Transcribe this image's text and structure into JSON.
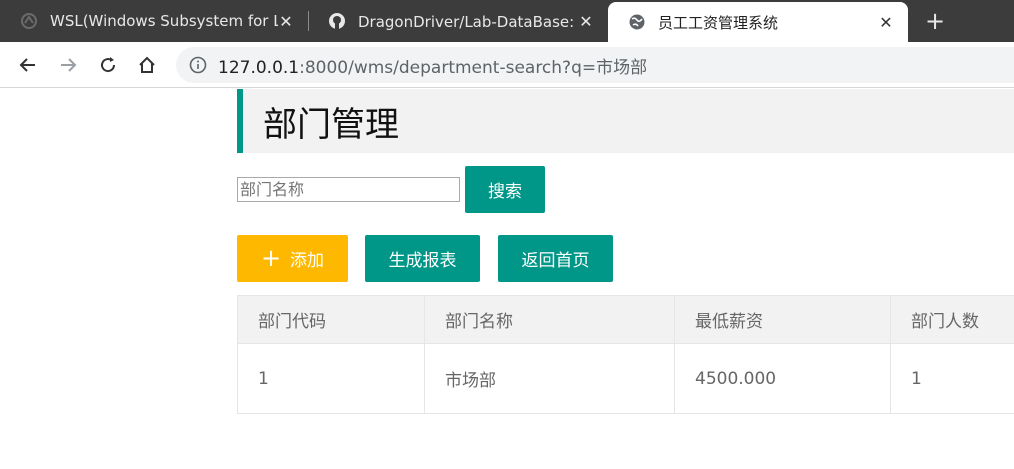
{
  "browser": {
    "tabs": [
      {
        "title": "WSL(Windows Subsystem for Linux)",
        "favicon": "wsl-icon"
      },
      {
        "title": "DragonDriver/Lab-DataBase: 华",
        "favicon": "github-icon"
      },
      {
        "title": "员工工资管理系统",
        "favicon": "globe-icon",
        "active": true
      }
    ],
    "close_glyph": "✕",
    "newtab_glyph": "+",
    "url_host": "127.0.0.1",
    "url_rest": ":8000/wms/department-search?q=市场部"
  },
  "page": {
    "heading": "部门管理",
    "search": {
      "placeholder": "部门名称",
      "value": "",
      "button_label": "搜索"
    },
    "actions": {
      "add_icon": "+",
      "add_label": "添加",
      "report_label": "生成报表",
      "home_label": "返回首页"
    },
    "table": {
      "headers": [
        "部门代码",
        "部门名称",
        "最低薪资",
        "部门人数"
      ],
      "rows": [
        [
          "1",
          "市场部",
          "4500.000",
          "1"
        ]
      ]
    }
  },
  "colors": {
    "accent": "#009688",
    "warning": "#ffb800",
    "tabstrip": "#3c3c3c"
  }
}
